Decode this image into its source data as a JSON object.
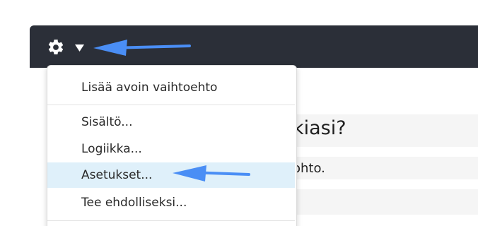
{
  "toolbar": {
    "gear_icon": "gear-icon",
    "caret_icon": "caret-down-icon"
  },
  "menu": {
    "items": [
      {
        "label": "Lisää avoin vaihtoehto"
      },
      {
        "label": "Sisältö..."
      },
      {
        "label": "Logiikka..."
      },
      {
        "label": "Asetukset..."
      },
      {
        "label": "Tee ehdolliseksi..."
      }
    ],
    "highlighted_item": "Asetukset...",
    "highlight_color": "#dff0fa"
  },
  "background": {
    "question_fragment": "kiasi?",
    "answer_fragment": "ohto."
  },
  "colors": {
    "toolbar_bg": "#2b2f38",
    "arrow": "#4a8ef5"
  }
}
